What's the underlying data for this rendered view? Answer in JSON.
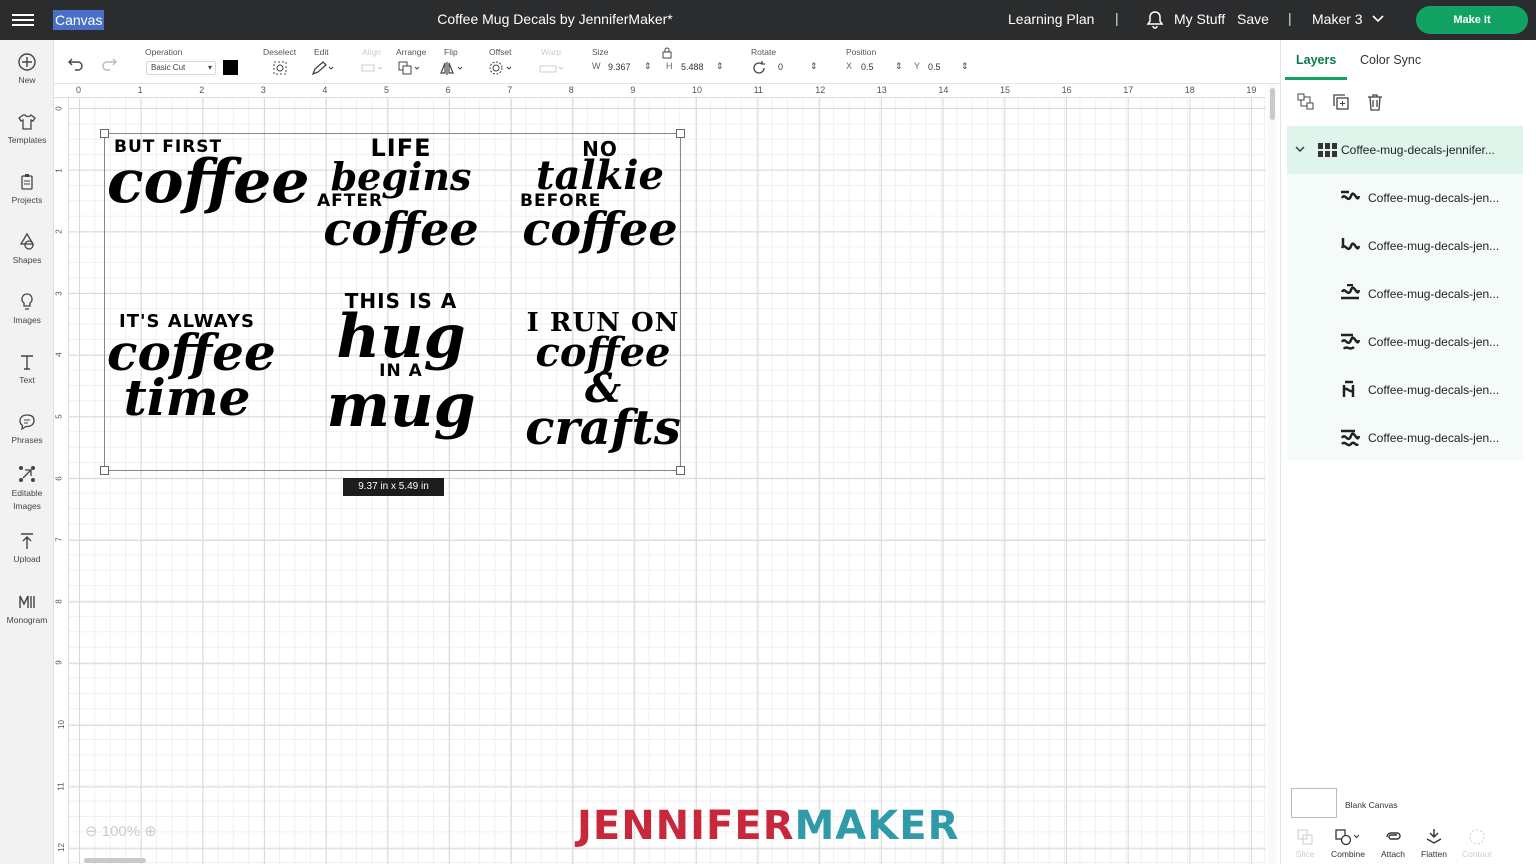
{
  "topbar": {
    "canvas_label": "Canvas",
    "doc_title": "Coffee Mug Decals by JenniferMaker*",
    "learning_plan": "Learning Plan",
    "separator": "|",
    "my_stuff": "My Stuff",
    "save": "Save",
    "machine": "Maker 3",
    "make_it": "Make It"
  },
  "sidebar": {
    "items": [
      {
        "label": "New",
        "icon": "plus-circle-icon"
      },
      {
        "label": "Templates",
        "icon": "shirt-icon"
      },
      {
        "label": "Projects",
        "icon": "clipboard-icon"
      },
      {
        "label": "Shapes",
        "icon": "shapes-icon"
      },
      {
        "label": "Images",
        "icon": "lightbulb-icon"
      },
      {
        "label": "Text",
        "icon": "text-icon"
      },
      {
        "label": "Phrases",
        "icon": "speech-bubble-icon"
      },
      {
        "label": "Editable Images",
        "icon": "editable-image-icon"
      },
      {
        "label": "Upload",
        "icon": "upload-icon"
      },
      {
        "label": "Monogram",
        "icon": "monogram-icon"
      }
    ]
  },
  "toolbar": {
    "operation_label": "Operation",
    "operation_value": "Basic Cut",
    "deselect_label": "Deselect",
    "edit_label": "Edit",
    "align_label": "Align",
    "arrange_label": "Arrange",
    "flip_label": "Flip",
    "offset_label": "Offset",
    "warp_label": "Warp",
    "size_label": "Size",
    "w_label": "W",
    "w_value": "9.367",
    "h_label": "H",
    "h_value": "5.488",
    "rotate_label": "Rotate",
    "rotate_value": "0",
    "position_label": "Position",
    "x_label": "X",
    "x_value": "0.5",
    "y_label": "Y",
    "y_value": "0.5",
    "color_hex": "#000000"
  },
  "ruler": {
    "top": [
      "0",
      "1",
      "2",
      "3",
      "4",
      "5",
      "6",
      "7",
      "8",
      "9",
      "10",
      "11",
      "12",
      "13",
      "14",
      "15",
      "16",
      "17",
      "18",
      "19"
    ],
    "left": [
      "0",
      "1",
      "2",
      "3",
      "4",
      "5",
      "6",
      "7",
      "8",
      "9",
      "10",
      "11",
      "12"
    ]
  },
  "canvas": {
    "decals": [
      {
        "small": "BUT FIRST",
        "big": "coffee"
      },
      {
        "small_top": "LIFE",
        "mid": "begins",
        "small": "AFTER",
        "big": "coffee"
      },
      {
        "small": "NO",
        "mid": "talkie",
        "small2": "BEFORE",
        "big": "coffee"
      },
      {
        "small": "IT'S ALWAYS",
        "big": "coffee",
        "big2": "time"
      },
      {
        "small": "THIS IS A",
        "big": "hug",
        "small2": "IN A",
        "big2": "mug"
      },
      {
        "small": "I RUN ON",
        "big": "coffee &",
        "big2": "crafts"
      }
    ],
    "dimensions": "9.37  in x 5.49  in",
    "zoom": "100%",
    "brand_part1": "JENNIFER",
    "brand_part2": "MAKER",
    "brand_color1": "#c8283b",
    "brand_color2": "#2f9aa8"
  },
  "rightpanel": {
    "tabs": [
      "Layers",
      "Color Sync"
    ],
    "group_name": "Coffee-mug-decals-jennifer...",
    "layers": [
      "Coffee-mug-decals-jen...",
      "Coffee-mug-decals-jen...",
      "Coffee-mug-decals-jen...",
      "Coffee-mug-decals-jen...",
      "Coffee-mug-decals-jen...",
      "Coffee-mug-decals-jen..."
    ],
    "blank_canvas": "Blank Canvas",
    "bottom_tools": [
      "Slice",
      "Combine",
      "Attach",
      "Flatten",
      "Contour"
    ]
  }
}
